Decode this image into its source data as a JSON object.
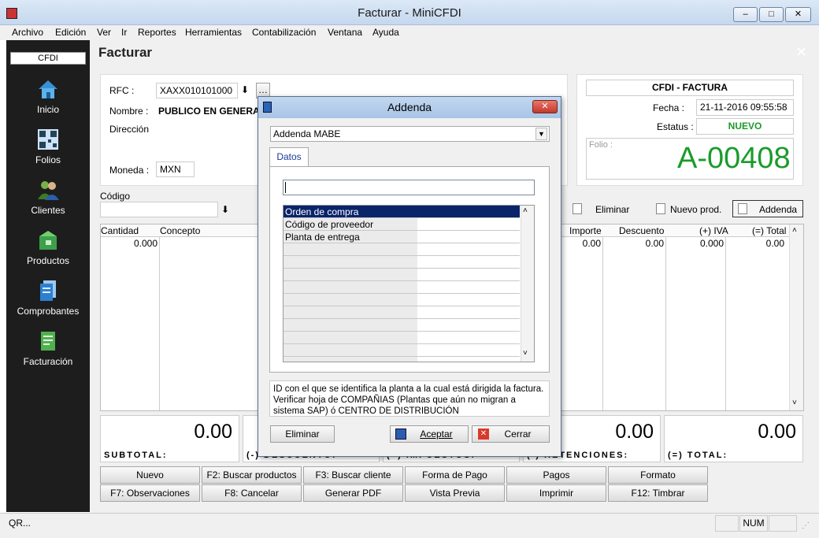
{
  "window": {
    "title": "Facturar - MiniCFDI",
    "min": "–",
    "max": "□",
    "close": "✕"
  },
  "menu": [
    "Archivo",
    "Edición",
    "Ver",
    "Ir",
    "Reportes",
    "Herramientas",
    "Contabilización",
    "Ventana",
    "Ayuda"
  ],
  "sidebar": {
    "tab": "CFDI",
    "items": [
      {
        "label": "Inicio",
        "icon": "home-icon"
      },
      {
        "label": "Folios",
        "icon": "qr-code-icon"
      },
      {
        "label": "Clientes",
        "icon": "clients-icon"
      },
      {
        "label": "Productos",
        "icon": "products-icon"
      },
      {
        "label": "Comprobantes",
        "icon": "documents-icon"
      },
      {
        "label": "Facturación",
        "icon": "invoice-icon"
      }
    ]
  },
  "page": {
    "title": "Facturar"
  },
  "client": {
    "rfc_label": "RFC :",
    "rfc_value": "XAXX010101000",
    "nombre_label": "Nombre :",
    "nombre_value": "PUBLICO EN GENERAL",
    "direccion_label": "Dirección",
    "moneda_label": "Moneda :",
    "moneda_value": "MXN"
  },
  "cfdi_panel": {
    "title": "CFDI - FACTURA",
    "fecha_label": "Fecha :",
    "fecha_value": "21-11-2016 09:55:58",
    "estatus_label": "Estatus :",
    "estatus_value": "NUEVO",
    "folio_label": "Folio :",
    "folio_value": "A-00408"
  },
  "codigo": {
    "label": "Código",
    "value": ""
  },
  "actions": {
    "eliminar": "Eliminar",
    "nuevo_prod": "Nuevo prod.",
    "addenda": "Addenda"
  },
  "grid": {
    "headers": [
      "Cantidad",
      "Concepto",
      "Importe",
      "Descuento",
      "(+) IVA",
      "(=) Total"
    ],
    "row": {
      "cantidad": "0.000",
      "importe": "0.00",
      "descuento": "0.00",
      "iva": "0.000",
      "total": "0.00"
    }
  },
  "totals": {
    "subtotal": {
      "value": "0.00",
      "label": "SUBTOTAL:"
    },
    "descuento": {
      "label": "(-) DESCUENTO:"
    },
    "impuestos": {
      "label": "(+) IMPUESTOS:"
    },
    "retenciones": {
      "value": "0.00",
      "label": "(-) RETENCIONES:"
    },
    "total": {
      "value": "0.00",
      "label": "(=) TOTAL:"
    }
  },
  "bottom_buttons": [
    [
      "Nuevo",
      "F2: Buscar productos",
      "F3: Buscar cliente",
      "Forma de Pago",
      "Pagos",
      "Formato"
    ],
    [
      "F7: Observaciones",
      "F8: Cancelar",
      "Generar PDF",
      "Vista Previa",
      "Imprimir",
      "F12:  Timbrar"
    ]
  ],
  "status": {
    "left": "QR...",
    "num": "NUM"
  },
  "dialog": {
    "title": "Addenda",
    "select_value": "Addenda MABE",
    "tab": "Datos",
    "input_value": "",
    "list": [
      "Orden de compra",
      "Código de proveedor",
      "Planta de entrega"
    ],
    "description": "ID con el que se identifica la planta a la cual está dirigida la factura. Verificar hoja de COMPAÑIAS (Plantas que aún no migran a sistema SAP) ó CENTRO DE DISTRIBUCIÓN",
    "eliminar": "Eliminar",
    "aceptar": "Aceptar",
    "cerrar": "Cerrar"
  },
  "colors": {
    "accent_green": "#1b9b2a",
    "selection": "#0a246a",
    "sidebar": "#1d1d1d"
  }
}
